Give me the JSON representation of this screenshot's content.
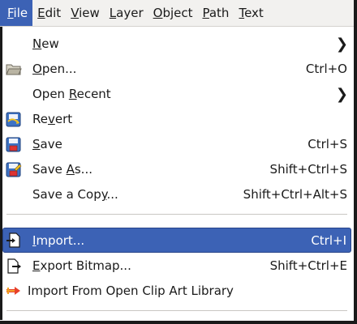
{
  "menubar": {
    "items": [
      {
        "label": "File",
        "mnemonic": "F",
        "rest": "ile",
        "active": true
      },
      {
        "label": "Edit",
        "mnemonic": "E",
        "rest": "dit"
      },
      {
        "label": "View",
        "mnemonic": "V",
        "rest": "iew"
      },
      {
        "label": "Layer",
        "mnemonic": "L",
        "rest": "ayer"
      },
      {
        "label": "Object",
        "mnemonic": "O",
        "rest": "bject"
      },
      {
        "label": "Path",
        "mnemonic": "P",
        "rest": "ath"
      },
      {
        "label": "Text",
        "mnemonic": "T",
        "rest": "ext"
      }
    ]
  },
  "menu": {
    "items": [
      {
        "pre": "",
        "mn": "N",
        "post": "ew",
        "accel": "",
        "icon": "none",
        "submenu": "›"
      },
      {
        "pre": "",
        "mn": "O",
        "post": "pen...",
        "accel": "Ctrl+O",
        "icon": "folder-open-icon"
      },
      {
        "pre": "Open ",
        "mn": "R",
        "post": "ecent",
        "accel": "",
        "icon": "none",
        "submenu": "›"
      },
      {
        "pre": "Re",
        "mn": "v",
        "post": "ert",
        "accel": "",
        "icon": "revert-icon"
      },
      {
        "pre": "",
        "mn": "S",
        "post": "ave",
        "accel": "Ctrl+S",
        "icon": "save-icon"
      },
      {
        "pre": "Save ",
        "mn": "A",
        "post": "s...",
        "accel": "Shift+Ctrl+S",
        "icon": "save-as-icon"
      },
      {
        "pre": "Save a Cop",
        "mn": "y",
        "post": "...",
        "accel": "Shift+Ctrl+Alt+S",
        "icon": "none"
      },
      {
        "pre": "",
        "mn": "I",
        "post": "mport...",
        "accel": "Ctrl+I",
        "icon": "import-icon",
        "highlighted": true
      },
      {
        "pre": "",
        "mn": "E",
        "post": "xport Bitmap...",
        "accel": "Shift+Ctrl+E",
        "icon": "export-bitmap-icon"
      },
      {
        "pre": "Import From Open Clip Art Library",
        "mn": "",
        "post": "",
        "accel": "",
        "icon": "clipart-icon"
      }
    ]
  },
  "colors": {
    "highlight": "#3c62b5",
    "menubar_bg": "#f2f1ef",
    "separator": "#c9c7c3"
  }
}
